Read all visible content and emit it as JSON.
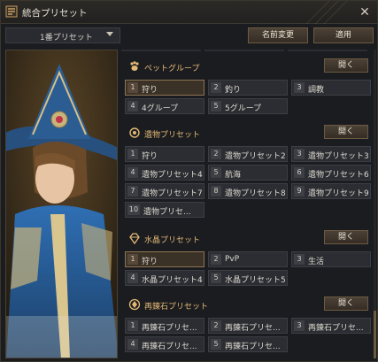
{
  "window": {
    "title": "統合プリセット",
    "close_icon": "close-icon"
  },
  "toolbar": {
    "preset_select_value": "1番プリセット",
    "rename_label": "名前変更",
    "apply_label": "適用"
  },
  "groups": {
    "pet": {
      "title": "ペットグループ",
      "open_label": "開く",
      "slots": [
        {
          "num": "1",
          "label": "狩り",
          "selected": true
        },
        {
          "num": "2",
          "label": "釣り"
        },
        {
          "num": "3",
          "label": "調教"
        },
        {
          "num": "4",
          "label": "4グループ"
        },
        {
          "num": "5",
          "label": "5グループ"
        }
      ]
    },
    "relic": {
      "title": "遺物プリセット",
      "open_label": "開く",
      "slots": [
        {
          "num": "1",
          "label": "狩り"
        },
        {
          "num": "2",
          "label": "遺物プリセット2"
        },
        {
          "num": "3",
          "label": "遺物プリセット3"
        },
        {
          "num": "4",
          "label": "遺物プリセット4"
        },
        {
          "num": "5",
          "label": "航海"
        },
        {
          "num": "6",
          "label": "遺物プリセット6"
        },
        {
          "num": "7",
          "label": "遺物プリセット7"
        },
        {
          "num": "8",
          "label": "遺物プリセット8"
        },
        {
          "num": "9",
          "label": "遺物プリセット9"
        },
        {
          "num": "10",
          "label": "遺物プリセ..."
        }
      ]
    },
    "crystal": {
      "title": "水晶プリセット",
      "open_label": "開く",
      "slots": [
        {
          "num": "1",
          "label": "狩り",
          "selected": true
        },
        {
          "num": "2",
          "label": "PvP"
        },
        {
          "num": "3",
          "label": "生活"
        },
        {
          "num": "4",
          "label": "水晶プリセット4"
        },
        {
          "num": "5",
          "label": "水晶プリセット5"
        }
      ]
    },
    "reforge": {
      "title": "再錬石プリセット",
      "open_label": "開く",
      "slots": [
        {
          "num": "1",
          "label": "再錬石プリセ..."
        },
        {
          "num": "2",
          "label": "再錬石プリセ..."
        },
        {
          "num": "3",
          "label": "再錬石プリセ..."
        },
        {
          "num": "4",
          "label": "再錬石プリセ..."
        },
        {
          "num": "5",
          "label": "再錬石プリセ..."
        }
      ]
    }
  },
  "colors": {
    "accent": "#e2b874",
    "button_border": "#6d5a42",
    "selected_bg": "#3a3127"
  }
}
